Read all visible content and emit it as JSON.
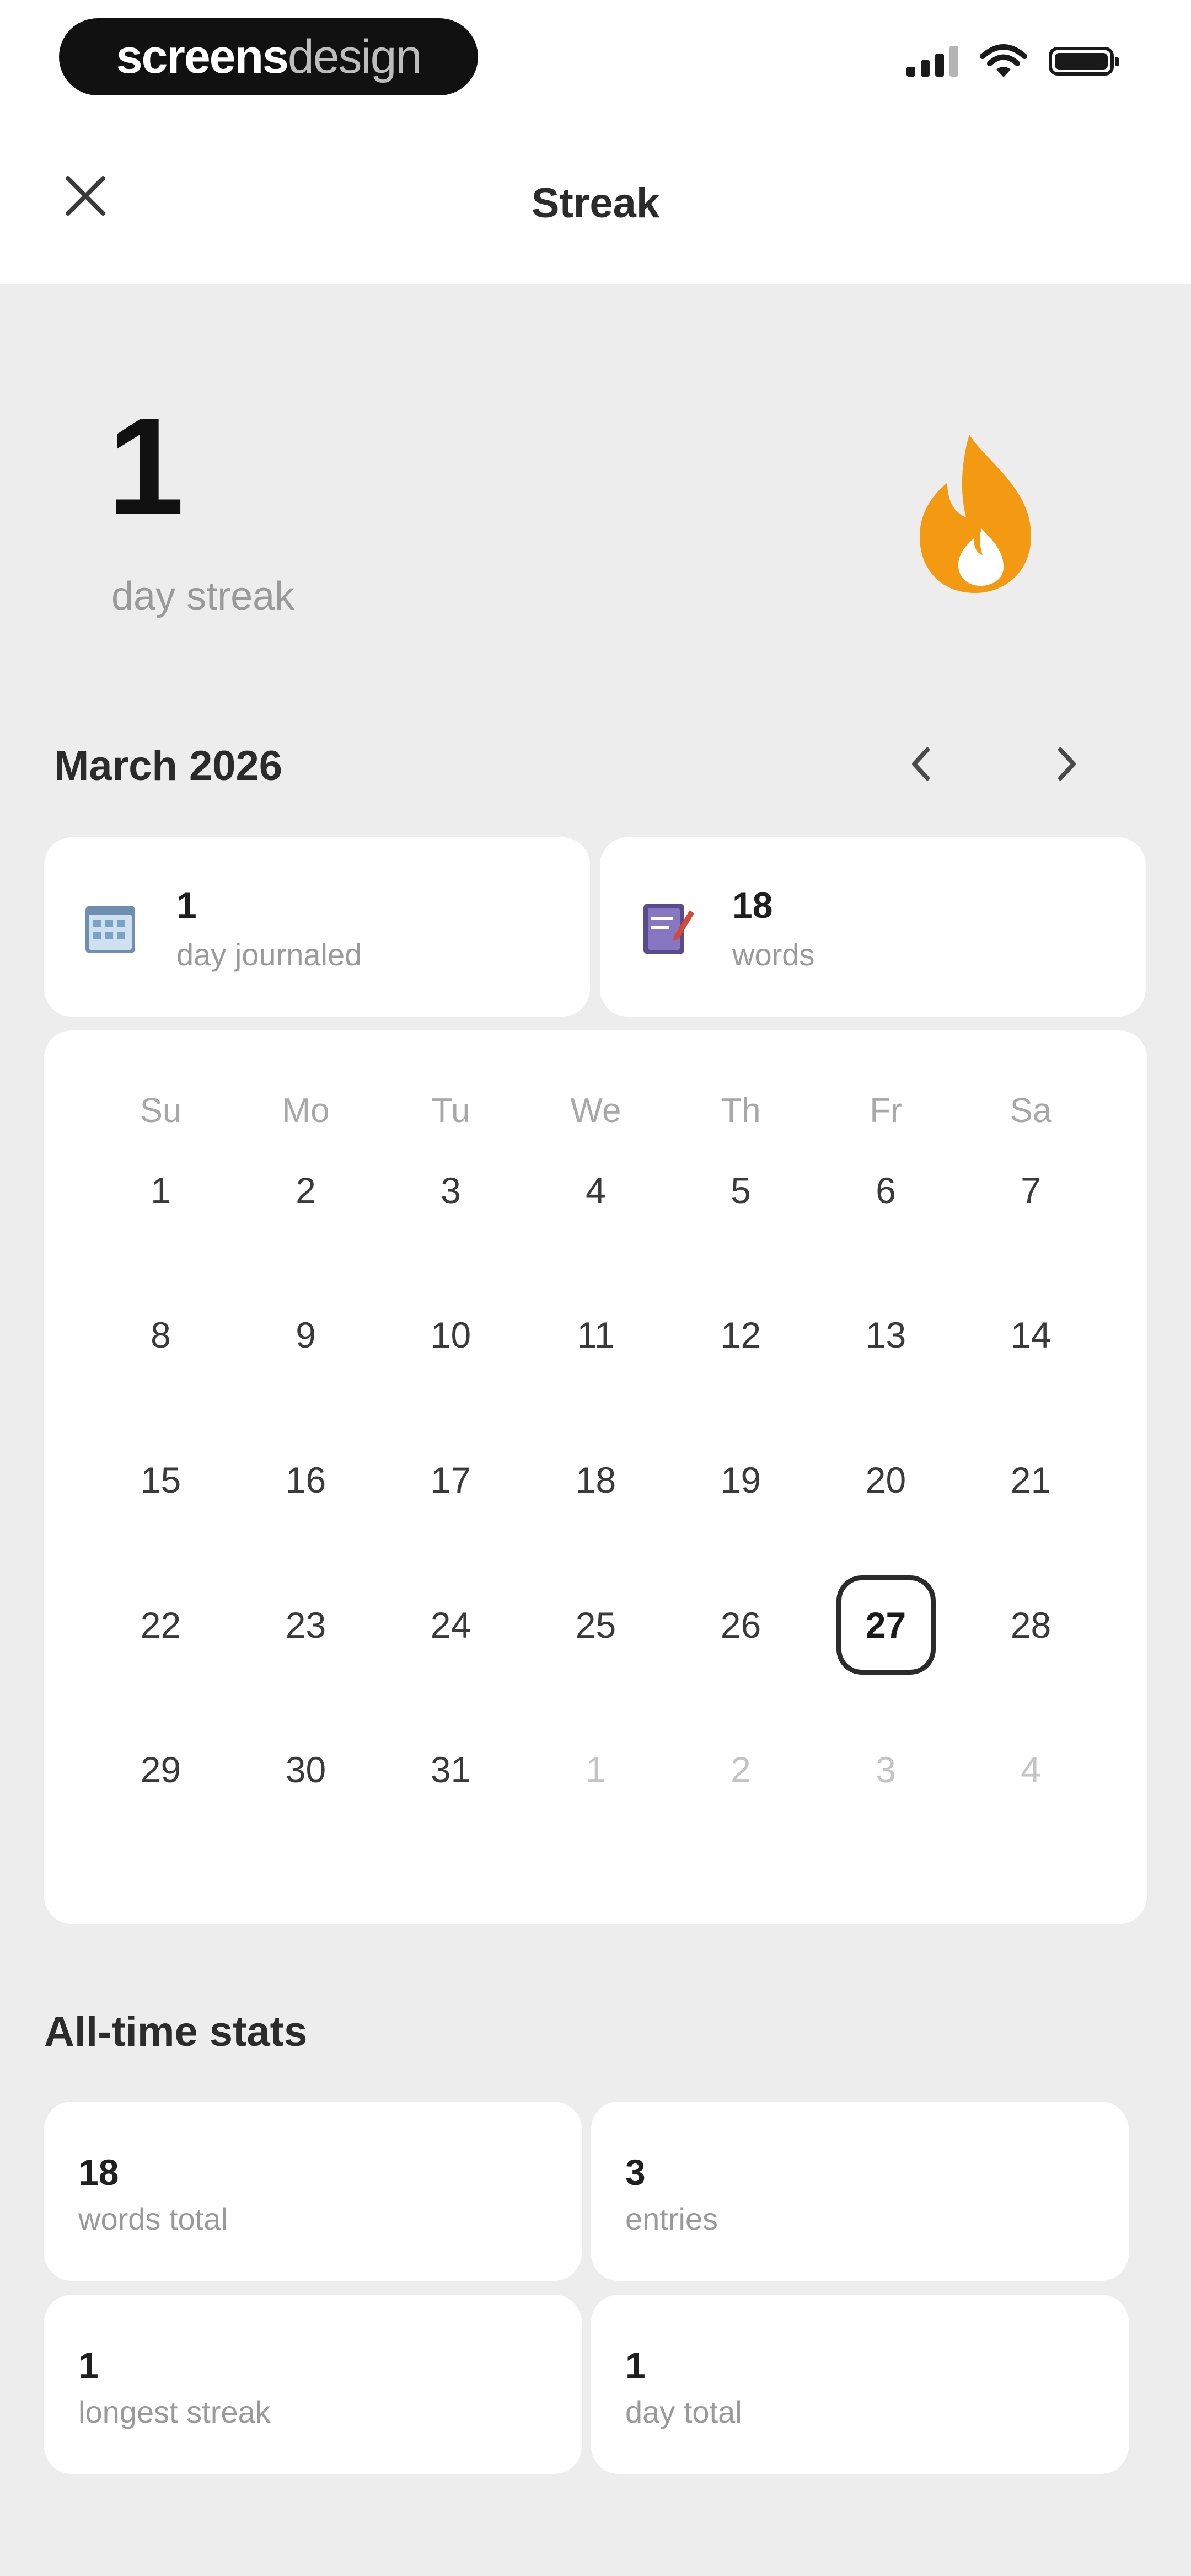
{
  "status_bar": {
    "brand_part1": "screens",
    "brand_part2": "design",
    "icons": [
      "signal-icon",
      "wifi-icon",
      "battery-icon"
    ]
  },
  "nav": {
    "title": "Streak",
    "close_icon": "close-icon"
  },
  "streak": {
    "count": "1",
    "label": "day streak",
    "icon": "flame-icon",
    "accent_color": "#F39A12"
  },
  "month": {
    "title": "March 2026",
    "prev_icon": "chevron-left-icon",
    "next_icon": "chevron-right-icon"
  },
  "month_stats": [
    {
      "value": "1",
      "label": "day journaled",
      "icon": "calendar-icon"
    },
    {
      "value": "18",
      "label": "words",
      "icon": "notebook-pen-icon"
    }
  ],
  "calendar": {
    "weekdays": [
      "Su",
      "Mo",
      "Tu",
      "We",
      "Th",
      "Fr",
      "Sa"
    ],
    "weeks": [
      [
        "1",
        "2",
        "3",
        "4",
        "5",
        "6",
        "7"
      ],
      [
        "8",
        "9",
        "10",
        "11",
        "12",
        "13",
        "14"
      ],
      [
        "15",
        "16",
        "17",
        "18",
        "19",
        "20",
        "21"
      ],
      [
        "22",
        "23",
        "24",
        "25",
        "26",
        "27",
        "28"
      ],
      [
        "29",
        "30",
        "31",
        "1",
        "2",
        "3",
        "4"
      ]
    ],
    "today": "27",
    "outside_days_last_row": [
      "1",
      "2",
      "3",
      "4"
    ]
  },
  "alltime": {
    "title": "All-time stats",
    "stats": [
      {
        "value": "18",
        "label": "words total"
      },
      {
        "value": "3",
        "label": "entries"
      },
      {
        "value": "1",
        "label": "longest streak"
      },
      {
        "value": "1",
        "label": "day total"
      }
    ]
  }
}
